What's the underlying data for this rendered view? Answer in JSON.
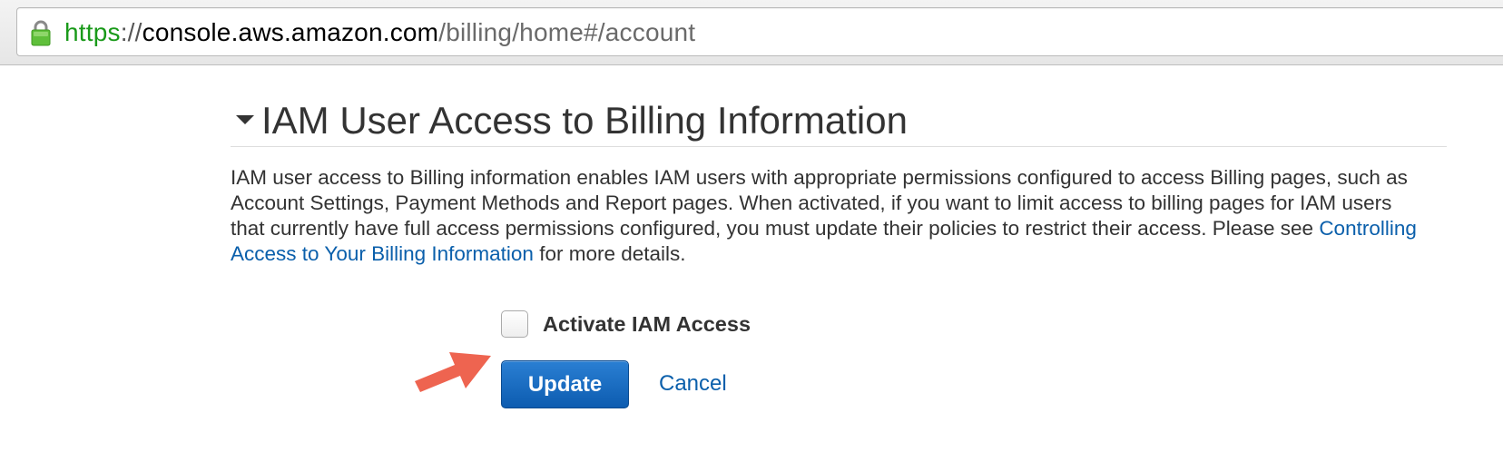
{
  "browser": {
    "url_scheme": "https",
    "url_separator": "://",
    "url_host": "console.aws.amazon.com",
    "url_path": "/billing/home#/account",
    "lock_icon": "lock-icon"
  },
  "section": {
    "title": "IAM User Access to Billing Information",
    "collapse_icon": "caret-down-icon",
    "description_prefix": "IAM user access to Billing information enables IAM users with appropriate permissions configured to access Billing pages, such as Account Settings, Payment Methods and Report pages. When activated, if you want to limit access to billing pages for IAM users that currently have full access permissions configured, you must update their policies to restrict their access. Please see ",
    "description_link": "Controlling Access to Your Billing Information",
    "description_suffix": " for more details."
  },
  "form": {
    "checkbox_label": "Activate IAM Access",
    "checkbox_checked": false,
    "update_label": "Update",
    "cancel_label": "Cancel"
  },
  "colors": {
    "link": "#0a5fab",
    "primary_button": "#1467bf",
    "annotation_arrow": "#ee6450",
    "url_scheme": "#1a9a1a"
  }
}
